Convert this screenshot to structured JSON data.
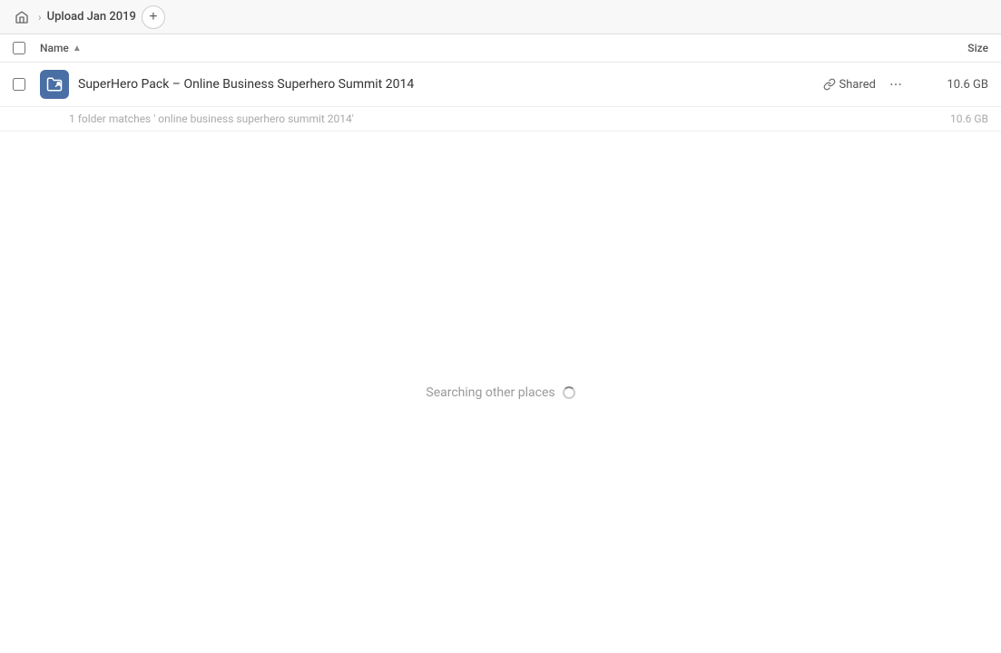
{
  "header": {
    "breadcrumb_label": "Upload Jan 2019",
    "add_button_label": "+",
    "home_icon": "home-icon"
  },
  "columns": {
    "name_label": "Name",
    "size_label": "Size",
    "sort_arrow": "▲"
  },
  "file_row": {
    "icon_semantic": "folder-share-icon",
    "name": "SuperHero Pack – Online Business Superhero Summit 2014",
    "shared_label": "Shared",
    "more_icon": "more-options-icon",
    "size": "10.6 GB"
  },
  "search_info": {
    "text": "1 folder matches ' online business superhero summit 2014'",
    "size": "10.6 GB"
  },
  "searching": {
    "label": "Searching other places",
    "spinner": true
  }
}
